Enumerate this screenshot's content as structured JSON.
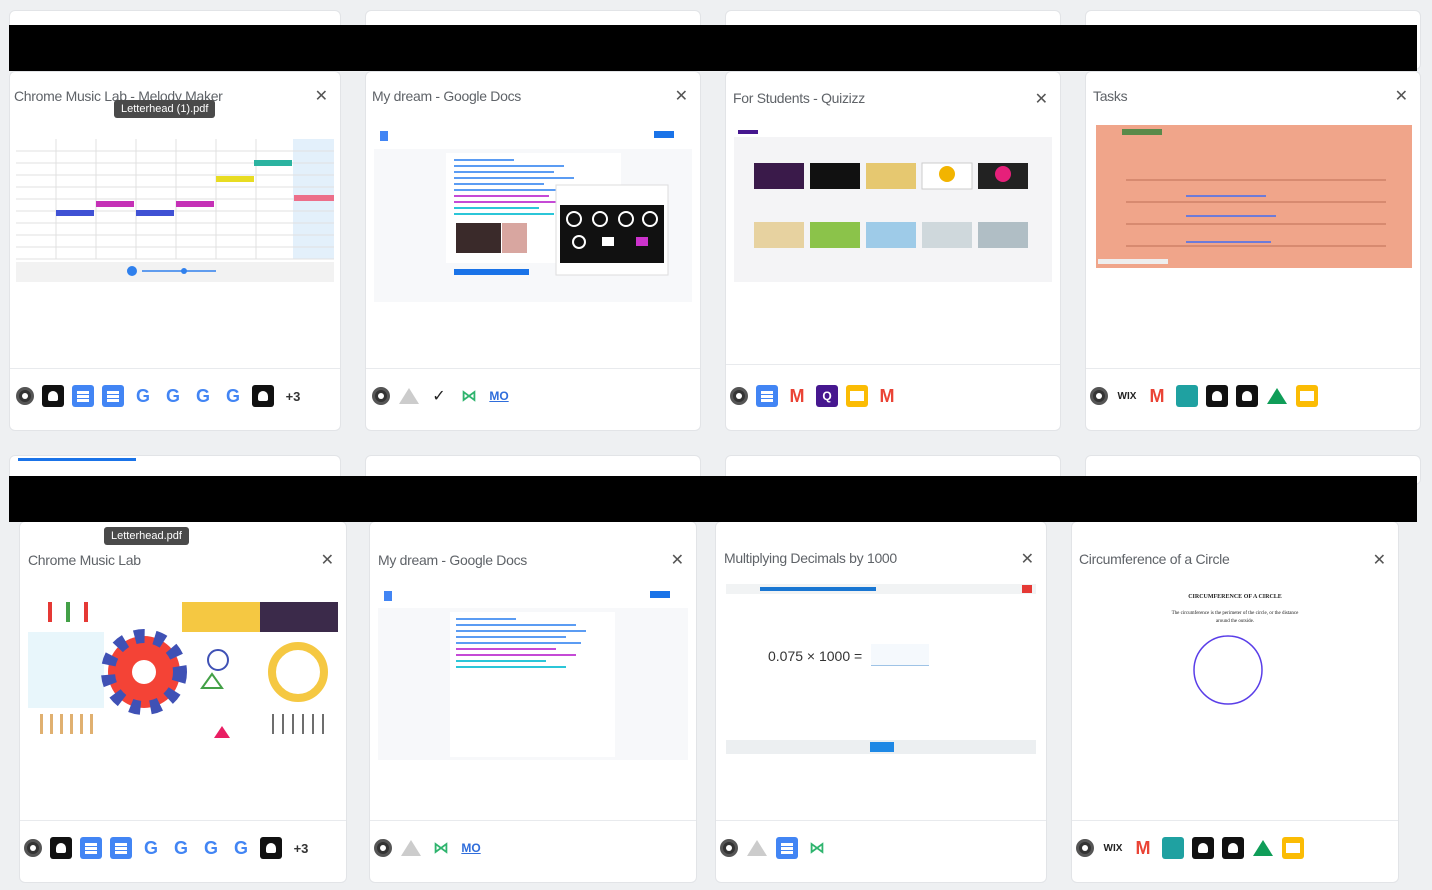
{
  "row1": {
    "cards": [
      {
        "title": "Chrome Music Lab - Melody Maker",
        "tooltip": "Letterhead (1).pdf",
        "plus": "+3"
      },
      {
        "title": "My dream - Google Docs"
      },
      {
        "title": "For Students - Quizizz"
      },
      {
        "title": "Tasks"
      }
    ]
  },
  "row2": {
    "cards": [
      {
        "title": "Chrome Music Lab",
        "tooltip": "Letterhead.pdf",
        "plus": "+3"
      },
      {
        "title": "My dream - Google Docs"
      },
      {
        "title": "Multiplying Decimals by 1000",
        "equation": "0.075 × 1000 ="
      },
      {
        "title": "Circumference of a Circle",
        "doc_heading": "CIRCUMFERENCE OF A CIRCLE",
        "doc_text": "The circumference is the perimeter of the circle, or the distance around the outside."
      }
    ]
  },
  "close_glyph": "✕",
  "icon_glyphs": {
    "g": "G",
    "gmail": "M",
    "wix": "WIX",
    "mo": "MO",
    "pen": "✓",
    "green": "⋈"
  },
  "colors": {
    "accent": "#1a73e8",
    "tasks_bg": "#f0a58a",
    "redaction": "#000000"
  }
}
